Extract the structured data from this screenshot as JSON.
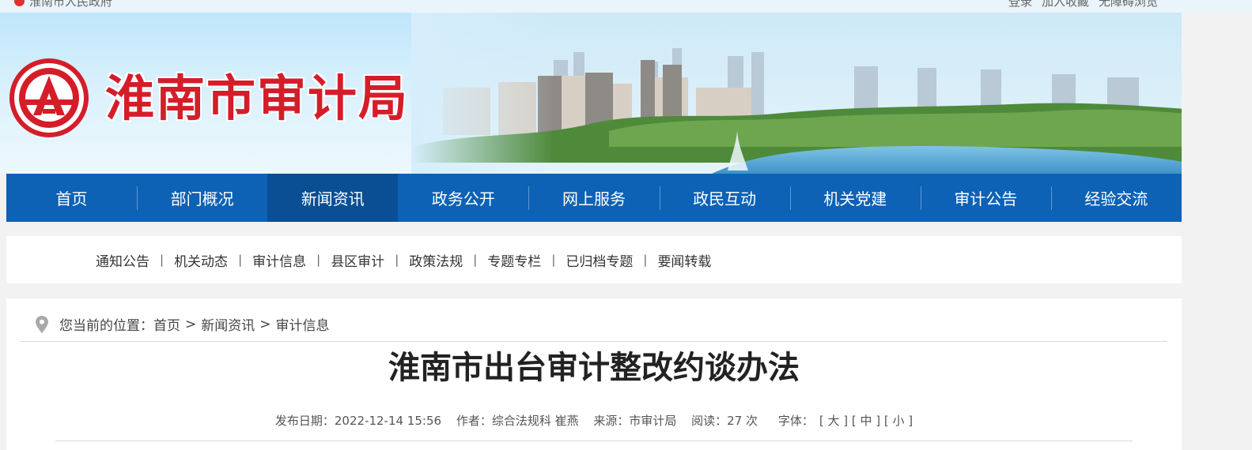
{
  "topbar": {
    "gov_link": "淮南市人民政府",
    "links": [
      "登录",
      "加入收藏",
      "无障碍浏览"
    ]
  },
  "header": {
    "site_title": "淮南市审计局",
    "logo_icon": "audit-emblem-icon",
    "brand_color": "#d51d2a"
  },
  "nav": {
    "active_color": "#0a4f93",
    "bar_color": "#0d62b5",
    "items": [
      {
        "label": "首页"
      },
      {
        "label": "部门概况"
      },
      {
        "label": "新闻资讯",
        "active": true
      },
      {
        "label": "政务公开"
      },
      {
        "label": "网上服务"
      },
      {
        "label": "政民互动"
      },
      {
        "label": "机关党建"
      },
      {
        "label": "审计公告"
      },
      {
        "label": "经验交流"
      }
    ]
  },
  "subnav": {
    "items": [
      "通知公告",
      "机关动态",
      "审计信息",
      "县区审计",
      "政策法规",
      "专题专栏",
      "已归档专题",
      "要闻转载"
    ],
    "separator": "|"
  },
  "breadcrumb": {
    "prefix": "您当前的位置：",
    "items": [
      "首页",
      "新闻资讯",
      "审计信息"
    ],
    "separator": ">",
    "icon": "location-pin-icon"
  },
  "article": {
    "title": "淮南市出台审计整改约谈办法",
    "meta": {
      "date": "发布日期：2022-12-14 15:56",
      "author": "作者：综合法规科 崔燕",
      "source": "来源：市审计局",
      "reads": "阅读：27 次",
      "font_label": "字体：",
      "font_large": "[ 大 ]",
      "font_medium": "[ 中 ]",
      "font_small": "[ 小 ]"
    }
  }
}
